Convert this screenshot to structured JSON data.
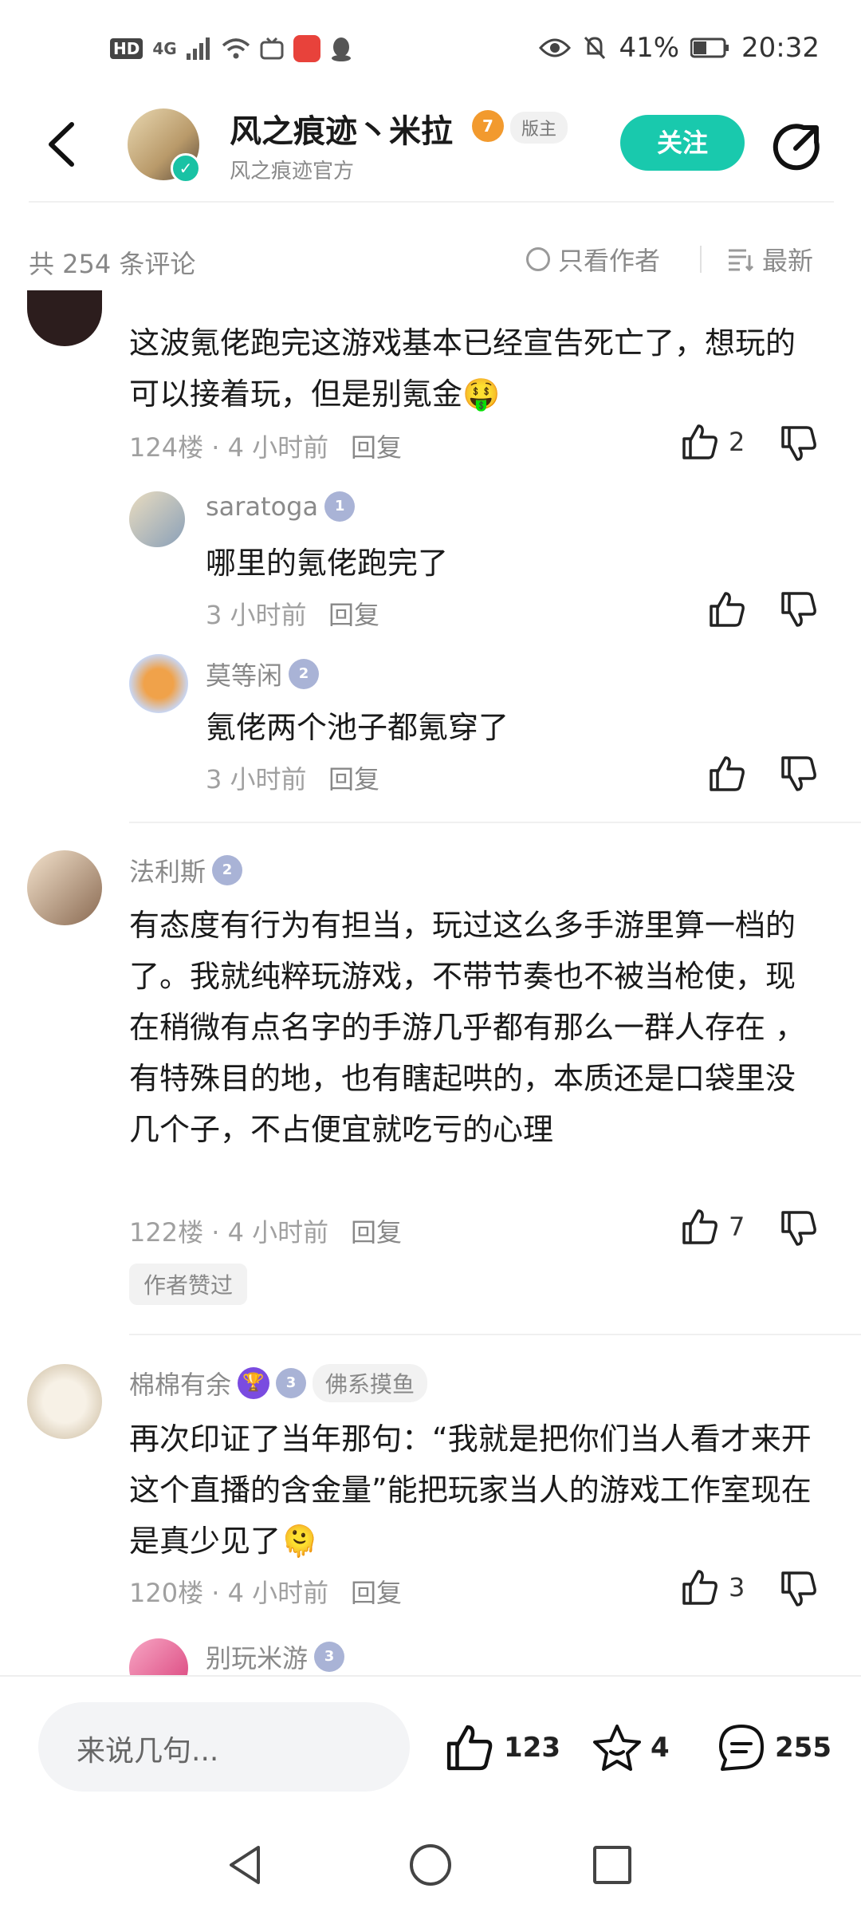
{
  "status_bar": {
    "left_icons": [
      "HD",
      "4G",
      "signal-icon",
      "wifi-icon",
      "tv-icon",
      "huawei-app-icon",
      "qq-icon"
    ],
    "battery": "41%",
    "time": "20:32"
  },
  "header": {
    "title": "风之痕迹丶米拉",
    "level": "7",
    "role_badge": "版主",
    "subtitle": "风之痕迹官方",
    "follow_label": "关注"
  },
  "comments_header": {
    "count": "共 254 条评论",
    "only_author": "只看作者",
    "sort": "最新"
  },
  "comments": [
    {
      "text": "这波氪佬跑完这游戏基本已经宣告死亡了，想玩的可以接着玩，但是别氪金🤑",
      "floor_time": "124楼 · 4 小时前",
      "reply_label": "回复",
      "likes": "2",
      "replies": [
        {
          "name": "saratoga",
          "level": "1",
          "text": "哪里的氪佬跑完了",
          "time": "3 小时前",
          "reply_label": "回复"
        },
        {
          "name": "莫等闲",
          "level": "2",
          "text": "氪佬两个池子都氪穿了",
          "time": "3 小时前",
          "reply_label": "回复"
        }
      ]
    },
    {
      "name": "法利斯",
      "level": "2",
      "text": "有态度有行为有担当，玩过这么多手游里算一档的了。我就纯粹玩游戏，不带节奏也不被当枪使，现在稍微有点名字的手游几乎都有那么一群人存在 ，有特殊目的地，也有瞎起哄的，本质还是口袋里没几个子，不占便宜就吃亏的心理",
      "floor_time": "122楼 · 4 小时前",
      "reply_label": "回复",
      "likes": "7",
      "author_liked": "作者赞过"
    },
    {
      "name": "棉棉有余",
      "level": "3",
      "tag": "佛系摸鱼",
      "text": "再次印证了当年那句：“我就是把你们当人看才来开这个直播的含金量”能把玩家当人的游戏工作室现在是真少见了🫠",
      "floor_time": "120楼 · 4 小时前",
      "reply_label": "回复",
      "likes": "3",
      "replies": [
        {
          "name": "别玩米游",
          "level": "3"
        }
      ]
    }
  ],
  "bottom_bar": {
    "placeholder": "来说几句...",
    "likes": "123",
    "favorites": "4",
    "comments": "255"
  },
  "colors": {
    "accent": "#19c9ad",
    "badge": "#a9b3d6",
    "level7": "#f29a2e"
  }
}
